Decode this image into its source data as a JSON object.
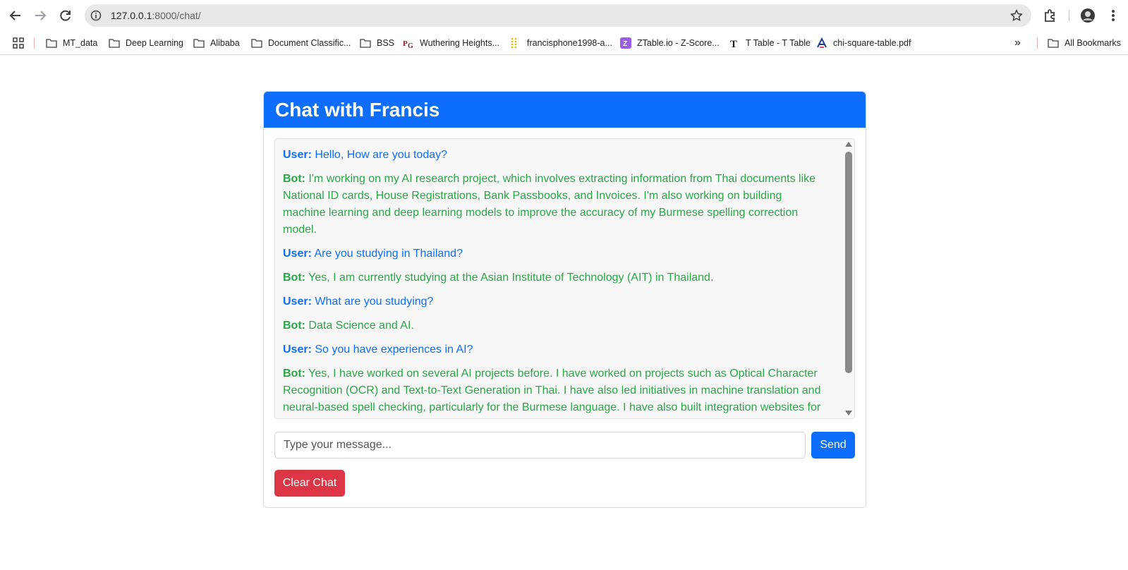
{
  "browser": {
    "url_host": "127.0.0.1",
    "url_path": ":8000/chat/",
    "icons": {
      "back": "back-arrow-icon",
      "forward": "forward-arrow-icon",
      "reload": "reload-icon",
      "info": "site-info-icon",
      "star": "bookmark-star-icon",
      "extensions": "extensions-icon",
      "menu": "kebab-menu-icon"
    }
  },
  "bookmarks": {
    "items": [
      {
        "label": "MT_data",
        "icon": "folder-icon"
      },
      {
        "label": "Deep Learning",
        "icon": "folder-icon"
      },
      {
        "label": "Alibaba",
        "icon": "folder-icon"
      },
      {
        "label": "Document Classific...",
        "icon": "folder-icon"
      },
      {
        "label": "BSS",
        "icon": "folder-icon"
      },
      {
        "label": "Wuthering Heights...",
        "icon": "pg-icon"
      },
      {
        "label": "francisphone1998-a...",
        "icon": "dots-icon"
      },
      {
        "label": "ZTable.io - Z-Score...",
        "icon": "z-icon"
      },
      {
        "label": "T Table - T Table",
        "icon": "t-icon"
      },
      {
        "label": "chi-square-table.pdf",
        "icon": "a-icon"
      }
    ],
    "overflow": "»",
    "all_bookmarks": "All Bookmarks"
  },
  "chat": {
    "title": "Chat with Francis",
    "messages": [
      {
        "role": "user",
        "speaker": "User:",
        "text": " Hello, How are you today?"
      },
      {
        "role": "bot",
        "speaker": "Bot:",
        "text": " I'm working on my AI research project, which involves extracting information from Thai documents like National ID cards, House Registrations, Bank Passbooks, and Invoices. I'm also working on building machine learning and deep learning models to improve the accuracy of my Burmese spelling correction model."
      },
      {
        "role": "user",
        "speaker": "User:",
        "text": " Are you studying in Thailand?"
      },
      {
        "role": "bot",
        "speaker": "Bot:",
        "text": " Yes, I am currently studying at the Asian Institute of Technology (AIT) in Thailand."
      },
      {
        "role": "user",
        "speaker": "User:",
        "text": " What are you studying?"
      },
      {
        "role": "bot",
        "speaker": "Bot:",
        "text": " Data Science and AI."
      },
      {
        "role": "user",
        "speaker": "User:",
        "text": " So you have experiences in AI?"
      },
      {
        "role": "bot",
        "speaker": "Bot:",
        "text": " Yes, I have worked on several AI projects before. I have worked on projects such as Optical Character Recognition (OCR) and Text-to-Text Generation in Thai. I have also led initiatives in machine translation and neural-based spell checking, particularly for the Burmese language. I have also built integration websites for NLP projects and explored and Analyzed data for NLP projects. I have also researched new technologies for"
      }
    ],
    "input_placeholder": "Type your message...",
    "send_label": "Send",
    "clear_label": "Clear Chat"
  },
  "colors": {
    "primary": "#0d6efd",
    "user_text": "#0d6efd",
    "bot_text": "#28a745",
    "danger": "#dc3545"
  }
}
